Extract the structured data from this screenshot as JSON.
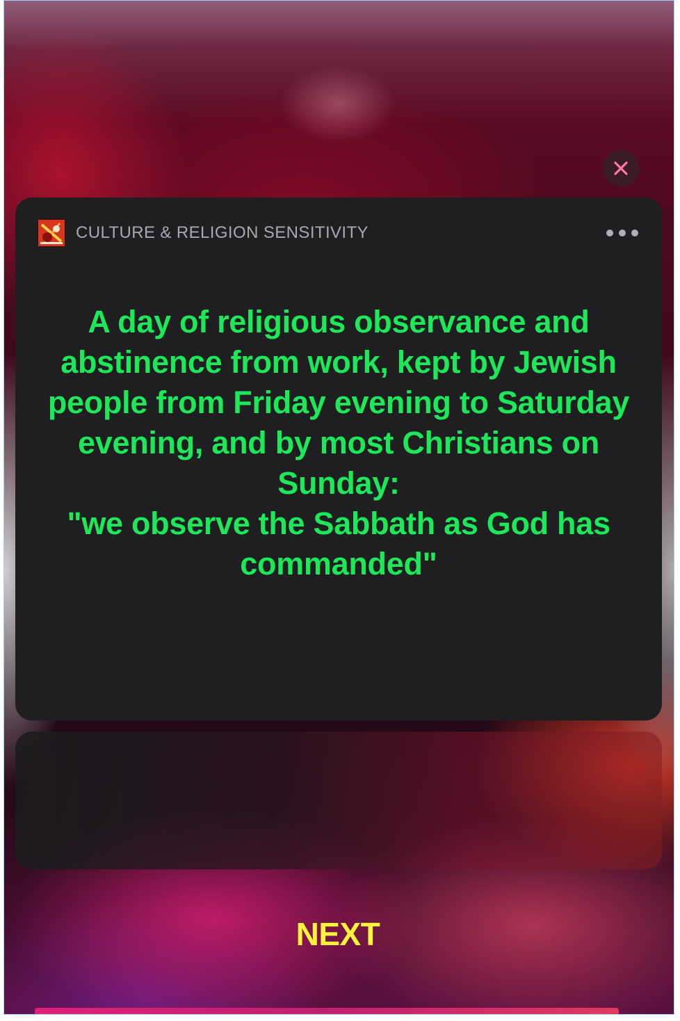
{
  "colors": {
    "definition_text": "#1de85a",
    "next_text": "#fff23a",
    "card_background": "#1f1f21",
    "close_icon": "#ff7aa2",
    "app_name_text": "#a9a9ad"
  },
  "card": {
    "app_icon": "app-logo-icon",
    "app_name": "CULTURE & RELIGION SENSITIVITY",
    "more_icon": "ellipsis-icon",
    "definition": "A day of religious observance and abstinence from work, kept by Jewish people from Friday evening to Saturday evening, and by most Christians on Sunday:\n\"we observe the Sabbath as God has commanded\""
  },
  "close_icon": "close-icon",
  "next_label": "NEXT"
}
